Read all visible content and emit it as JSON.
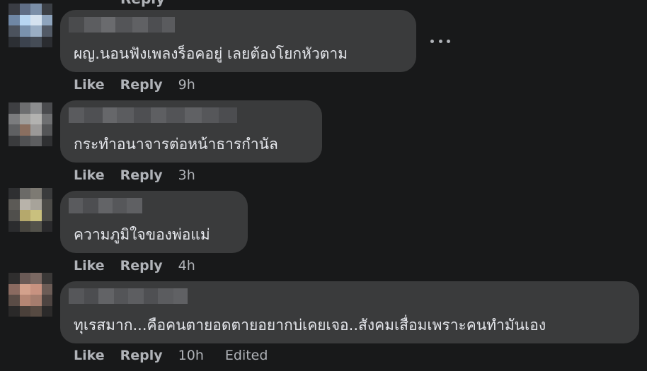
{
  "top_partial_label": "Reply",
  "colors": {
    "background": "#18191a",
    "bubble": "#3a3b3c",
    "text": "#e4e6eb",
    "secondary_text": "#b0b3b8"
  },
  "comments": [
    {
      "text": "ผญ.นอนฟังเพลงร็อคอยู่ เลยต้องโยกหัวตาม",
      "like_label": "Like",
      "reply_label": "Reply",
      "time": "9h",
      "edited": "",
      "more_icon": "more-horizontal-icon"
    },
    {
      "text": "กระทำอนาจารต่อหน้าธารกำนัล",
      "like_label": "Like",
      "reply_label": "Reply",
      "time": "3h",
      "edited": ""
    },
    {
      "text": "ความภูมิใจของพ่อแม่",
      "like_label": "Like",
      "reply_label": "Reply",
      "time": "4h",
      "edited": ""
    },
    {
      "text": "ทุเรสมาก...คือคนตายอดตายอยากบ่เคยเจอ..สังคมเสื่อมเพราะคนทำมันเอง",
      "like_label": "Like",
      "reply_label": "Reply",
      "time": "10h",
      "edited": "Edited"
    }
  ]
}
